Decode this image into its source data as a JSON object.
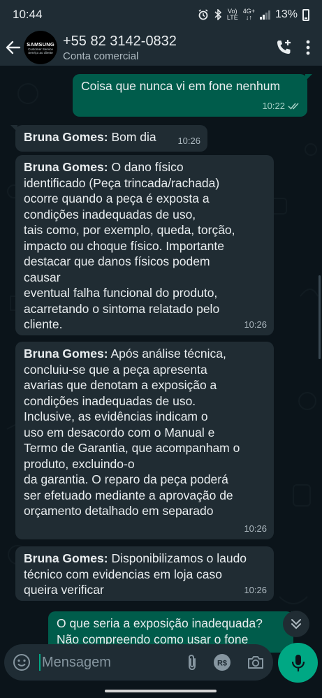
{
  "status_bar": {
    "time": "10:44",
    "network_vo": "Vo)",
    "network_lte": "LTE",
    "network_4g": "4G+",
    "battery": "13%"
  },
  "header": {
    "contact_name": "+55 82 3142-0832",
    "contact_status": "Conta comercial",
    "avatar_brand": "SAMSUNG",
    "avatar_line1": "Customer Service",
    "avatar_line2": "Serviço ao cliente"
  },
  "messages": [
    {
      "direction": "out",
      "sender": "",
      "text": "Coisa que nunca vi em fone nenhum",
      "time": "10:22"
    },
    {
      "direction": "in",
      "sender": "Bruna Gomes:",
      "text": "Bom dia",
      "time": "10:26"
    },
    {
      "direction": "in",
      "sender": "Bruna Gomes:",
      "text": "O dano físico\nidentificado (Peça trincada/rachada)\nocorre quando a peça é exposta a\ncondições inadequadas de uso,\ntais como, por exemplo, queda, torção,\nimpacto ou choque físico. Importante\ndestacar que danos físicos podem\ncausar\neventual falha funcional do produto,\nacarretando o sintoma relatado pelo\ncliente.",
      "time": "10:26"
    },
    {
      "direction": "in",
      "sender": "Bruna Gomes:",
      "text": "Após análise técnica,\nconcluiu-se que a peça apresenta\navarias que denotam a exposição a\ncondições inadequadas de uso.\nInclusive, as evidências indicam o\nuso em desacordo com o Manual e\nTermo de Garantia, que acompanham o\nproduto, excluindo-o\nda garantia. O reparo da peça poderá\nser efetuado mediante a aprovação de\norçamento detalhado em separado",
      "time": "10:26"
    },
    {
      "direction": "in",
      "sender": "Bruna Gomes:",
      "text": "Disponibilizamos o laudo\ntécnico com evidencias em loja caso\nqueira verificar",
      "time": "10:26"
    },
    {
      "direction": "out",
      "sender": "",
      "text": "O que seria a exposição inadequada?\nNão compreendo como usar o fone",
      "time": ""
    }
  ],
  "composer": {
    "placeholder": "Mensagem"
  },
  "icons": {
    "back": "arrow-left-icon",
    "add_call": "phone-plus-icon",
    "menu": "more-vertical-icon",
    "emoji": "emoji-icon",
    "attach": "paperclip-icon",
    "payment": "real-payment-icon",
    "camera": "camera-icon",
    "mic": "microphone-icon",
    "scroll": "chevron-double-down-icon",
    "read_receipt": "double-check-icon"
  },
  "colors": {
    "outgoing_bubble": "#005c4b",
    "incoming_bubble": "#202c33",
    "accent": "#00a884",
    "background": "#0b141a"
  }
}
